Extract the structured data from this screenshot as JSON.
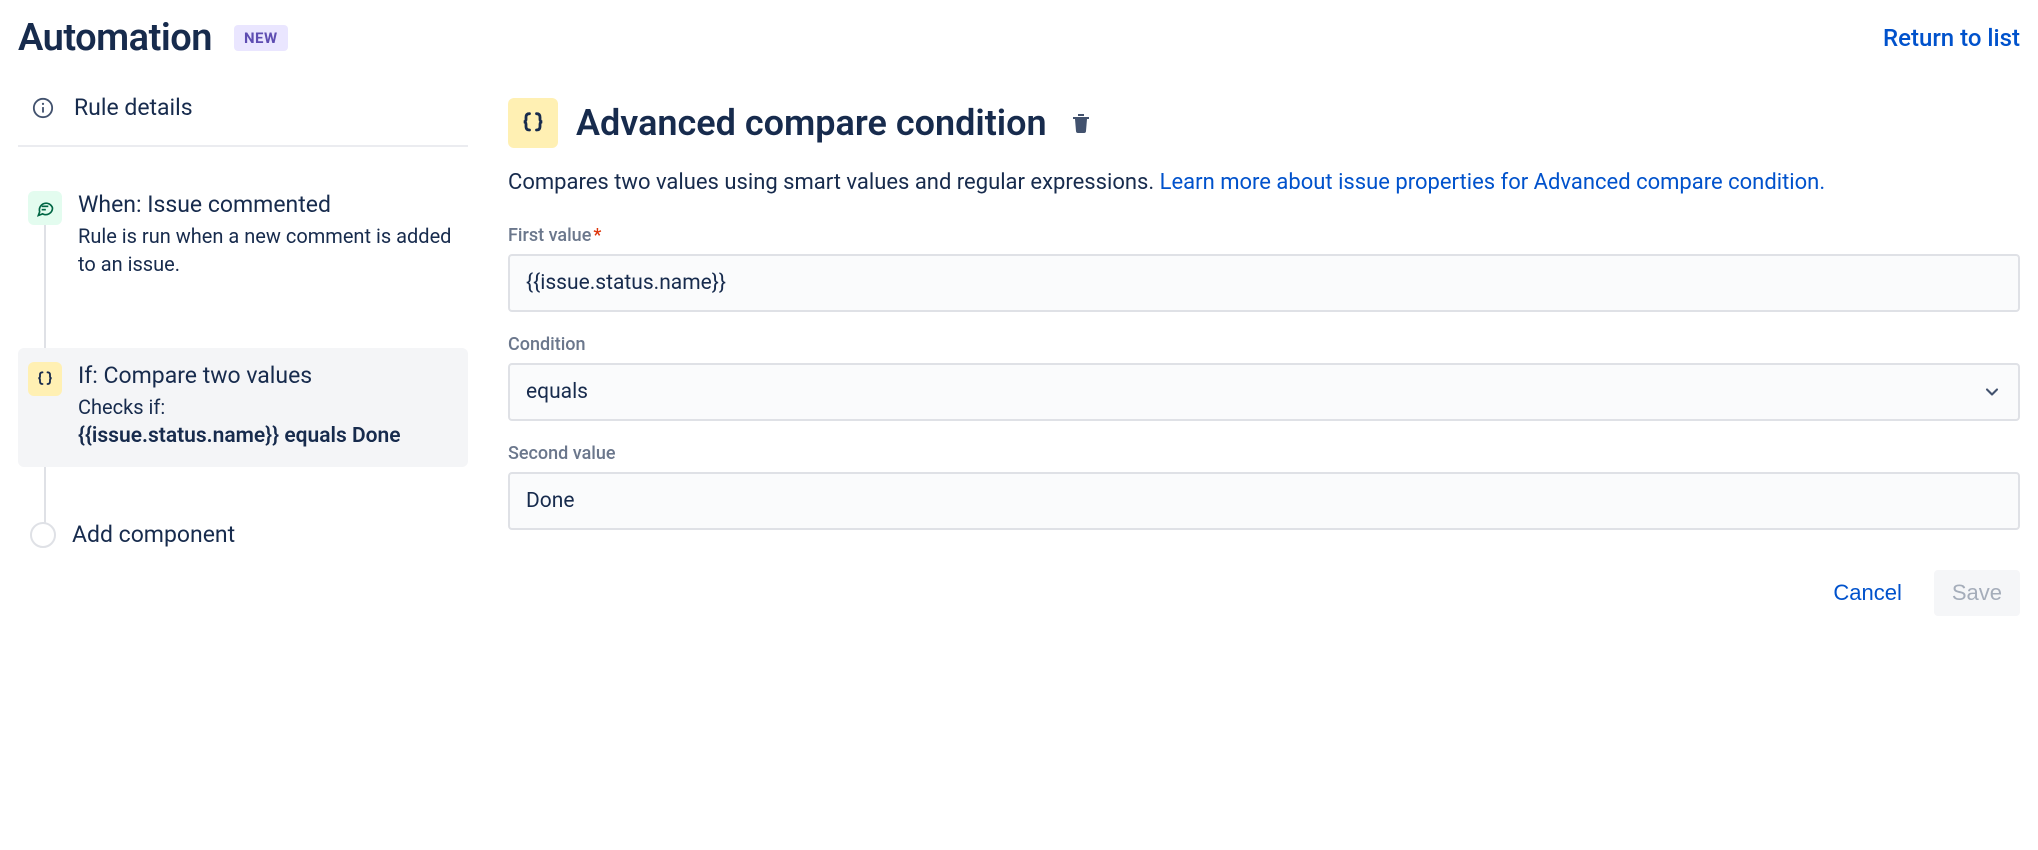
{
  "header": {
    "title": "Automation",
    "badge": "NEW",
    "return_link": "Return to list"
  },
  "sidebar": {
    "rule_details_label": "Rule details",
    "steps": [
      {
        "icon": "comment-icon",
        "icon_color": "green",
        "title": "When: Issue commented",
        "desc": "Rule is run when a new comment is added to an issue.",
        "selected": false
      },
      {
        "icon": "braces-icon",
        "icon_color": "yellow",
        "title": "If: Compare two values",
        "desc_prefix": "Checks if:",
        "desc_bold": "{{issue.status.name}} equals Done",
        "selected": true
      }
    ],
    "add_component_label": "Add component"
  },
  "panel": {
    "title": "Advanced compare condition",
    "desc_text": "Compares two values using smart values and regular expressions. ",
    "desc_link": "Learn more about issue properties for Advanced compare condition.",
    "fields": {
      "first_value": {
        "label": "First value",
        "required": true,
        "value": "{{issue.status.name}}"
      },
      "condition": {
        "label": "Condition",
        "required": false,
        "value": "equals"
      },
      "second_value": {
        "label": "Second value",
        "required": false,
        "value": "Done"
      }
    },
    "actions": {
      "cancel": "Cancel",
      "save": "Save"
    }
  }
}
